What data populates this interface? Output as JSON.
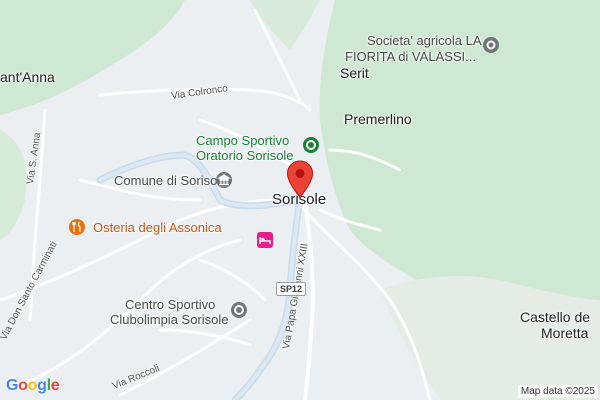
{
  "labels": {
    "sant_anna": "ant'Anna",
    "via_colronco": "Via Colronco",
    "via_s_anna": "Via S. Anna",
    "campo_sportivo": "Campo Sportivo",
    "oratorio_sorisole": "Oratorio Sorisole",
    "comune": "Comune di Sorisole",
    "sorisole": "Sorisole",
    "osteria": "Osteria degli Assonica",
    "via_don_santo": "Via Don Santo Carminati",
    "centro_sportivo": "Centro Sportivo",
    "clubolimpia": "Clubolimpia Sorisole",
    "via_roccoli": "Via Roccoli",
    "via_papa": "Via Papa Giovanni XXIII",
    "sp12": "SP12",
    "societa_line1": "Societa' agricola LA",
    "societa_line2": "FIORITA di VALASSI...",
    "serit": "Serit",
    "premerlino": "Premerlino",
    "castello_line1": "Castello de",
    "castello_line2": "Moretta"
  },
  "logo": {
    "letters": [
      "G",
      "o",
      "o",
      "g",
      "l",
      "e"
    ],
    "colors": [
      "#4285F4",
      "#EA4335",
      "#FBBC05",
      "#4285F4",
      "#34A853",
      "#EA4335"
    ]
  },
  "attribution": "Map data ©2025",
  "colors": {
    "forest": "#cfe8d3",
    "urban": "#eceff1",
    "road": "#ffffff",
    "road_highlight": "#c6dcef",
    "pin": "#ea4335",
    "poi_green": "#188038",
    "poi_orange": "#e8710a",
    "poi_gray": "#70757a",
    "hotel_pink": "#e91e8c"
  },
  "icons": {
    "pin": "map-pin-icon",
    "sports": "sports-venue-icon",
    "townhall": "town-hall-icon",
    "restaurant": "restaurant-icon",
    "hotel": "hotel-icon"
  }
}
